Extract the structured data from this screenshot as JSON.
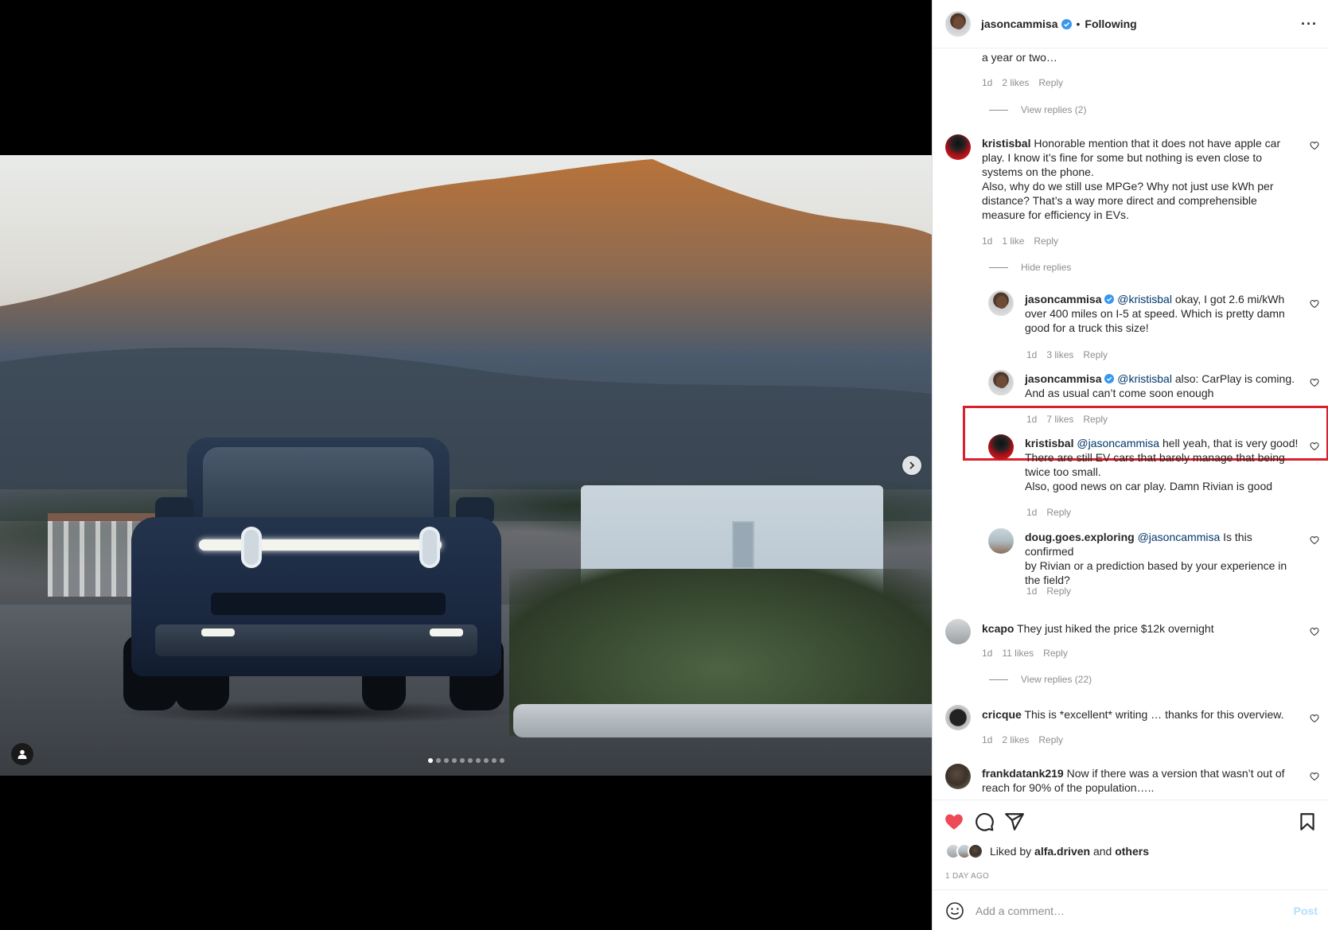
{
  "header": {
    "username": "jasoncammisa",
    "separator": "•",
    "follow_status": "Following",
    "more_label": "···"
  },
  "comments": {
    "top_fragment": "a year or two…",
    "top_meta": {
      "time": "1d",
      "likes": "2 likes",
      "reply": "Reply"
    },
    "top_view_replies": "View replies (2)",
    "c1": {
      "user": "kristisbal",
      "text_lines": [
        "Honorable mention that it does not have apple car",
        "play. I know it’s fine for some but nothing is even close to",
        "systems on the phone.",
        "Also, why do we still use MPGe? Why not just use kWh per",
        "distance? That’s a way more direct and comprehensible",
        "measure for efficiency in EVs."
      ],
      "time": "1d",
      "likes": "1 like",
      "reply": "Reply",
      "hide_replies": "Hide replies"
    },
    "r1": {
      "user": "jasoncammisa",
      "mention": "@kristisbal",
      "text_lines": [
        "okay, I got 2.6 mi/kWh",
        "over 400 miles on I-5 at speed. Which is pretty damn",
        "good for a truck this size!"
      ],
      "time": "1d",
      "likes": "3 likes",
      "reply": "Reply"
    },
    "r2": {
      "user": "jasoncammisa",
      "mention": "@kristisbal",
      "text_lines": [
        "also: CarPlay is coming.",
        "And as usual can’t come soon enough"
      ],
      "time": "1d",
      "likes": "7 likes",
      "reply": "Reply"
    },
    "r3": {
      "user": "kristisbal",
      "mention": "@jasoncammisa",
      "text_lines": [
        "hell yeah, that is very good!",
        "There are still EV cars that barely manage that being",
        "twice too small.",
        "Also, good news on car play. Damn Rivian is good"
      ],
      "time": "1d",
      "reply": "Reply"
    },
    "r4": {
      "user": "doug.goes.exploring",
      "mention": "@jasoncammisa",
      "text_lines": [
        "Is this confirmed",
        "by Rivian or a prediction based by your experience in",
        "the field?"
      ],
      "time": "1d",
      "reply": "Reply"
    },
    "c2": {
      "user": "kcapo",
      "text": "They just hiked the price $12k overnight",
      "time": "1d",
      "likes": "11 likes",
      "reply": "Reply",
      "view_replies": "View replies (22)"
    },
    "c3": {
      "user": "cricque",
      "text": "This is *excellent* writing … thanks for this overview.",
      "time": "1d",
      "likes": "2 likes",
      "reply": "Reply"
    },
    "c4": {
      "user": "frankdatank219",
      "text_lines": [
        "Now if there was a version that wasn’t out of",
        "reach for 90% of the population….."
      ]
    }
  },
  "actions": {
    "liked_prefix": "Liked by",
    "liked_user": "alfa.driven",
    "liked_and": "and",
    "liked_others": "others",
    "time_ago": "1 DAY AGO",
    "comment_placeholder": "Add a comment…",
    "post_label": "Post"
  },
  "colors": {
    "heart_liked": "#ed4956",
    "highlight": "#d9202c",
    "mention": "#00376b"
  },
  "carousel": {
    "total": 10,
    "active_index": 1
  }
}
